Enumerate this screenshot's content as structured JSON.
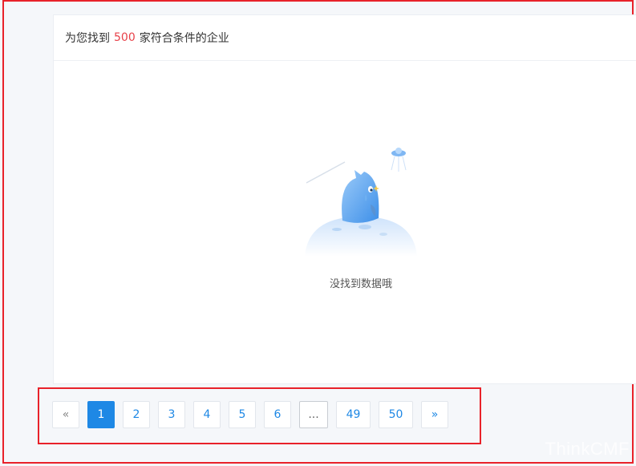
{
  "results": {
    "prefix": "为您找到",
    "count": "500",
    "suffix": "家符合条件的企业"
  },
  "empty_state": {
    "message": "没找到数据哦",
    "illustration_icon": "crying-bird-icon"
  },
  "pagination": {
    "prev": "«",
    "next": "»",
    "pages": [
      "1",
      "2",
      "3",
      "4",
      "5",
      "6",
      "...",
      "49",
      "50"
    ],
    "active": "1"
  },
  "watermark": "ThinkCMF",
  "colors": {
    "accent": "#1e88e5",
    "count_red": "#e8424a",
    "frame_red": "#e8222a"
  }
}
